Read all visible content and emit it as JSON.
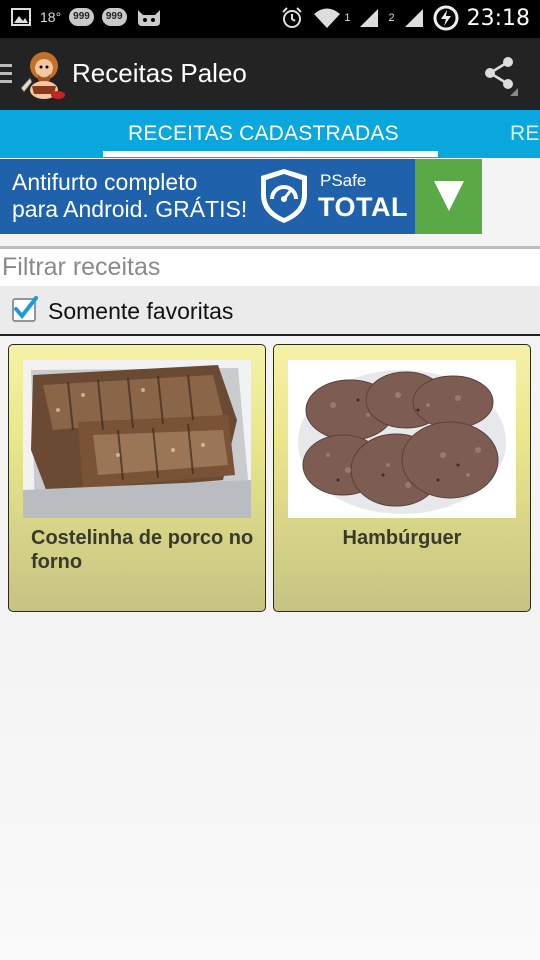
{
  "status_bar": {
    "temperature": "18°",
    "badge_1": "999",
    "badge_2": "999",
    "sim_1": "1",
    "sim_2": "2",
    "time": "23:18"
  },
  "app": {
    "title": "Receitas Paleo",
    "logo_icon": "caveman-logo-icon",
    "share_icon": "share-icon"
  },
  "tabs": [
    {
      "label": "RECEITAS CADASTRADAS",
      "selected": true
    },
    {
      "label": "RE",
      "selected": false
    }
  ],
  "ad": {
    "line1": "Antifurto completo",
    "line2": "para Android. GRÁTIS!",
    "brand_small": "PSafe",
    "brand_big": "TOTAL",
    "download_icon": "down-arrow-icon"
  },
  "filter": {
    "placeholder": "Filtrar receitas",
    "value": ""
  },
  "favorites": {
    "label": "Somente favoritas",
    "checked": true
  },
  "recipes": [
    {
      "title": "Costelinha de porco no forno",
      "image": "pork-ribs-photo"
    },
    {
      "title": "Hambúrguer",
      "image": "burger-patties-photo"
    }
  ],
  "colors": {
    "action_bar": "#232323",
    "tab_bar": "#0aa6de",
    "ad_background": "#1f62ab",
    "ad_button": "#5aa947",
    "card_top": "#f5f2a7",
    "card_bottom": "#c6c384",
    "checkbox": "#1e9bd7"
  }
}
